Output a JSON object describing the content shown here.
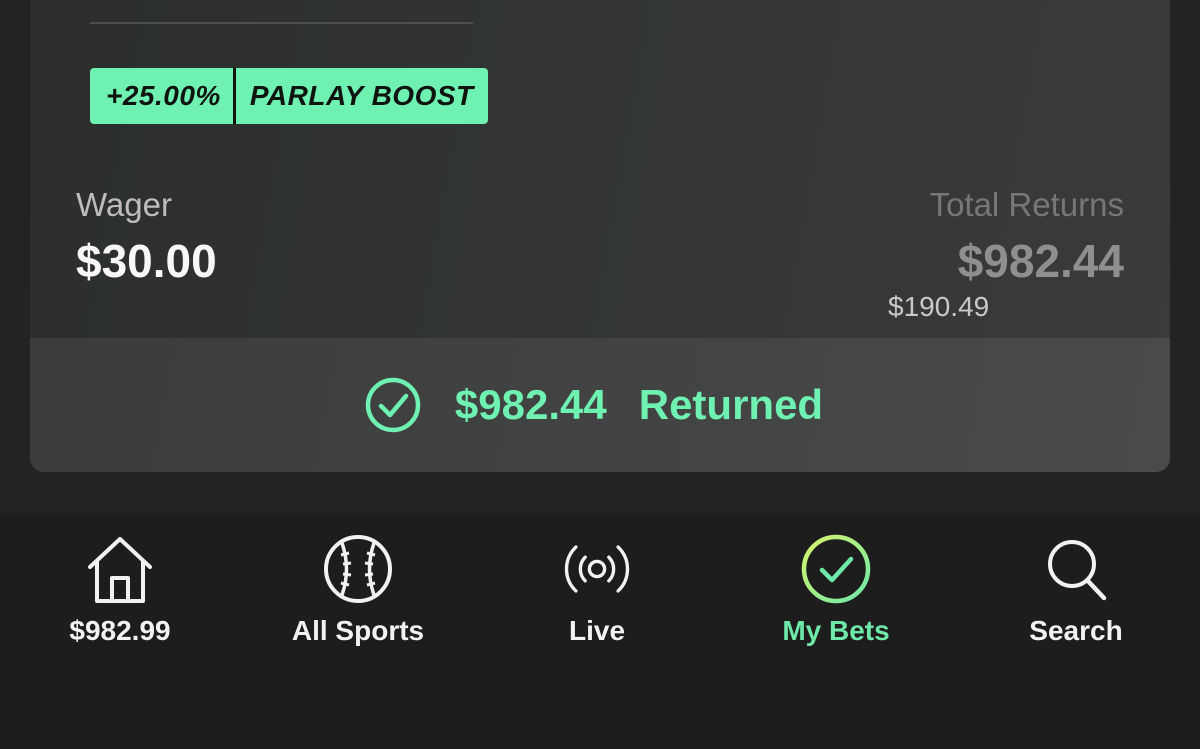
{
  "bet": {
    "boost_percent": "+25.00%",
    "boost_label": "PARLAY BOOST",
    "wager_label": "Wager",
    "wager_value": "$30.00",
    "total_returns_label": "Total Returns",
    "total_returns_value": "$982.44",
    "total_returns_sub": "$190.49",
    "returned_amount": "$982.44",
    "returned_text": "Returned",
    "status_icon": "check-circle-icon"
  },
  "tabbar": {
    "items": [
      {
        "label": "$982.99",
        "icon": "home-icon"
      },
      {
        "label": "All Sports",
        "icon": "baseball-icon"
      },
      {
        "label": "Live",
        "icon": "live-broadcast-icon"
      },
      {
        "label": "My Bets",
        "icon": "check-circle-icon",
        "active": true
      },
      {
        "label": "Search",
        "icon": "search-icon"
      }
    ]
  },
  "colors": {
    "accent": "#6ef1b1",
    "background": "#232323",
    "tabbar_background": "#1d1d1d"
  }
}
